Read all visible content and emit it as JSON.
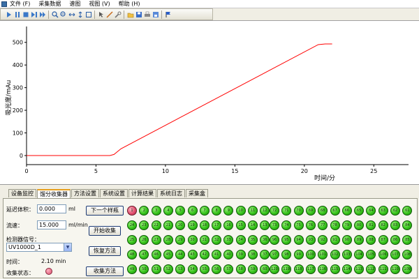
{
  "menubar": {
    "items": [
      "文件 (F)",
      "采集数据",
      "谱图",
      "视图 (V)",
      "帮助 (H)"
    ]
  },
  "toolbar": {
    "icons": [
      "play-icon",
      "pause-icon",
      "stop-icon",
      "step-icon",
      "record-icon",
      "sep",
      "zoom-in-icon",
      "zoom-out-icon",
      "zoom-x-icon",
      "zoom-y-icon",
      "fit-icon",
      "sep2",
      "cursor-icon",
      "measure-icon",
      "tools-icon",
      "sep3",
      "open-icon",
      "save-icon",
      "print-icon",
      "save-as-icon",
      "sep4",
      "flag-icon"
    ]
  },
  "chart_data": {
    "type": "line",
    "title": "",
    "xlabel": "时间/分",
    "ylabel": "吸光度/mAu",
    "xlim": [
      0,
      27.5
    ],
    "ylim": [
      -40,
      570
    ],
    "xticks": [
      0,
      5,
      10,
      15,
      20,
      25
    ],
    "yticks": [
      0,
      100,
      200,
      300,
      400,
      500
    ],
    "grid": false,
    "series": [
      {
        "color": "#ff0000",
        "x": [
          0,
          6.0,
          6.3,
          6.5,
          6.8,
          21.0,
          21.5,
          22.0
        ],
        "y": [
          0,
          0,
          5,
          15,
          30,
          490,
          493,
          493
        ]
      }
    ]
  },
  "tabs": [
    "设备监控",
    "馏分收集器",
    "方法设置",
    "系统设置",
    "计算结果",
    "系统日志",
    "采集盒"
  ],
  "active_tab": "馏分收集器",
  "form": {
    "delay_label": "延迟体积：",
    "delay_value": "0.000",
    "delay_unit": "ml",
    "flow_label": "流速：",
    "flow_value": "15.000",
    "flow_unit": "ml/min",
    "detector_label": "检测器信号：",
    "detector_value": "UV1000D_1",
    "time_label": "时间：",
    "time_value": "2.10 min",
    "status_label": "收集状态：",
    "status_color": "#e0506e"
  },
  "buttons": {
    "next_sample": "下一个样瓶",
    "start_collect": "开始收集",
    "restore_method": "恢复方法",
    "collect_method": "收集方法"
  },
  "tube_block_left": [
    [
      1,
      2,
      3,
      4,
      5,
      6,
      7,
      8,
      9,
      10,
      11,
      12
    ],
    [
      24,
      23,
      22,
      21,
      20,
      19,
      18,
      17,
      16,
      15,
      14,
      13
    ],
    [
      25,
      26,
      27,
      28,
      29,
      30,
      31,
      32,
      33,
      34,
      35,
      36
    ],
    [
      48,
      47,
      46,
      45,
      44,
      43,
      42,
      41,
      40,
      39,
      38,
      37
    ],
    [
      49,
      50,
      51,
      52,
      53,
      54,
      55,
      56,
      57,
      58,
      59,
      60
    ]
  ],
  "tube_block_right": [
    [
      72,
      71,
      70,
      69,
      68,
      67,
      66,
      65,
      64,
      63,
      62,
      61
    ],
    [
      73,
      74,
      75,
      76,
      77,
      78,
      79,
      80,
      81,
      82,
      83,
      84
    ],
    [
      96,
      95,
      94,
      93,
      92,
      91,
      90,
      89,
      88,
      87,
      86,
      85
    ],
    [
      97,
      98,
      99,
      100,
      101,
      102,
      103,
      104,
      105,
      106,
      107,
      108
    ],
    [
      120,
      119,
      118,
      117,
      116,
      115,
      114,
      113,
      112,
      111,
      110,
      109
    ]
  ],
  "active_tube": 1
}
